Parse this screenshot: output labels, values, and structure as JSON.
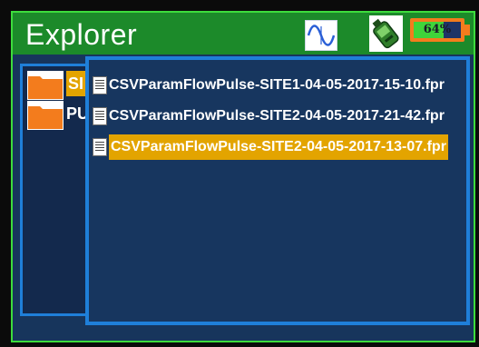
{
  "header": {
    "title": "Explorer",
    "icons": [
      "sine-wave-icon",
      "device-icon",
      "battery-icon"
    ],
    "battery_percent": 64,
    "battery_label": "64%"
  },
  "folders": {
    "items": [
      {
        "label": "SI",
        "selected": true
      },
      {
        "label": "PU",
        "selected": false
      }
    ]
  },
  "files": {
    "items": [
      {
        "label": "CSVParamFlowPulse-SITE1-04-05-2017-15-10.fpr",
        "selected": false
      },
      {
        "label": "CSVParamFlowPulse-SITE2-04-05-2017-21-42.fpr",
        "selected": false
      },
      {
        "label": "CSVParamFlowPulse-SITE2-04-05-2017-13-07.fpr",
        "selected": true
      }
    ]
  },
  "colors": {
    "title_bar": "#1c8a2a",
    "frame_border": "#3ddc3d",
    "pane_border": "#1f7fd9",
    "selection": "#e3a400",
    "battery": "#f37c1d",
    "battery_fill": "#3fd43a"
  }
}
